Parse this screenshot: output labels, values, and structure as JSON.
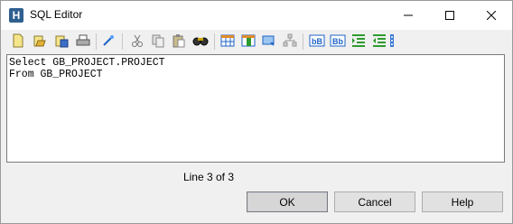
{
  "window": {
    "title": "SQL Editor",
    "app_icon": "H"
  },
  "editor": {
    "lines": [
      "Select GB_PROJECT.PROJECT",
      "From GB_PROJECT"
    ]
  },
  "status": {
    "line_info": "Line 3 of 3"
  },
  "buttons": {
    "ok": "OK",
    "cancel": "Cancel",
    "help": "Help"
  },
  "toolbar_icons": [
    "new-icon",
    "open-icon",
    "save-icon",
    "print-icon",
    "query-builder-icon",
    "cut-icon",
    "copy-icon",
    "paste-icon",
    "find-icon",
    "table-icon",
    "table-columns-icon",
    "comment-icon",
    "schema-icon",
    "lowercase-icon",
    "capitalize-icon",
    "indent-icon",
    "outdent-icon"
  ],
  "colors": {
    "accent_blue": "#1e63c6",
    "green": "#2e9b2e",
    "title_bg": "#ffffff",
    "window_bg": "#f0f0f0"
  }
}
